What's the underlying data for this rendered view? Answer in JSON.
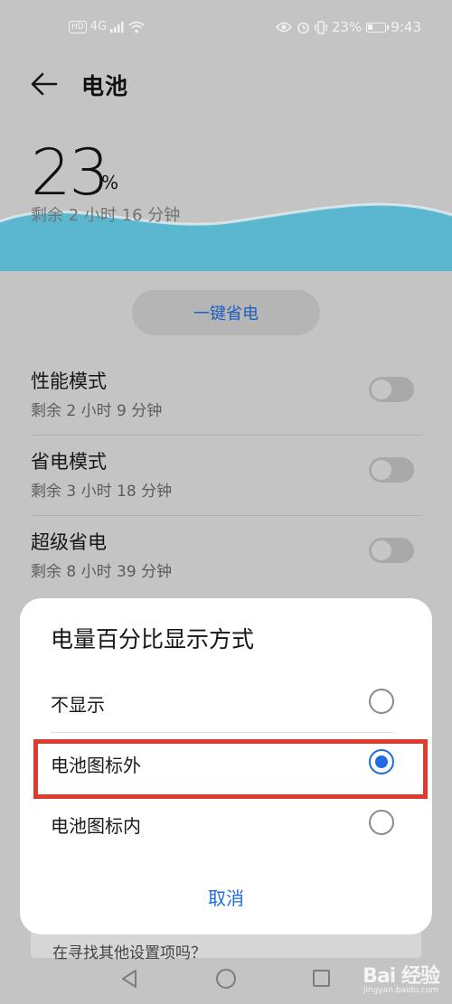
{
  "status_bar": {
    "left_network": "4G",
    "battery_percent": "23%",
    "time": "9:43"
  },
  "header": {
    "title": "电池"
  },
  "battery": {
    "percent": "23",
    "percent_sign": "%",
    "remaining": "剩余 2 小时 16 分钟",
    "wave_color": "#5bb6cf"
  },
  "save_button_label": "一键省电",
  "modes": [
    {
      "name": "性能模式",
      "remaining": "剩余 2 小时 9 分钟"
    },
    {
      "name": "省电模式",
      "remaining": "剩余 3 小时 18 分钟"
    },
    {
      "name": "超级省电",
      "remaining": "剩余 8 小时 39 分钟"
    }
  ],
  "background_hint": "在寻找其他设置项吗？",
  "dialog": {
    "title": "电量百分比显示方式",
    "options": [
      {
        "label": "不显示",
        "selected": false
      },
      {
        "label": "电池图标外",
        "selected": true
      },
      {
        "label": "电池图标内",
        "selected": false
      }
    ],
    "cancel_label": "取消",
    "accent_color": "#1e6ce0",
    "highlight_color": "#e03a2e"
  },
  "watermark": {
    "logo": "Bai 经验",
    "sub": "jingyan.baidu.com"
  }
}
